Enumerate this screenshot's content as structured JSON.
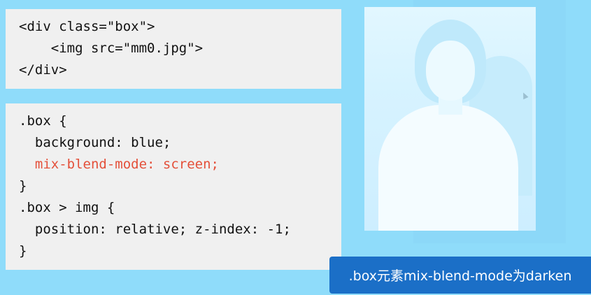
{
  "html_code": {
    "lines": [
      "<div class=\"box\">",
      "    <img src=\"mm0.jpg\">",
      "</div>"
    ]
  },
  "css_code": {
    "lines": [
      ".box {",
      "  background: blue;",
      "  mix-blend-mode: screen;",
      "}",
      ".box > img {",
      "  position: relative; z-index: -1;",
      "}"
    ]
  },
  "caption": ".box元素mix-blend-mode为darken",
  "colors": {
    "background": "#8fdcfa",
    "code_panel": "#f0f0f0",
    "highlight": "#e4503a",
    "caption_bg": "#1b6fc7"
  },
  "icons": [
    "mouse-cursor-icon"
  ]
}
